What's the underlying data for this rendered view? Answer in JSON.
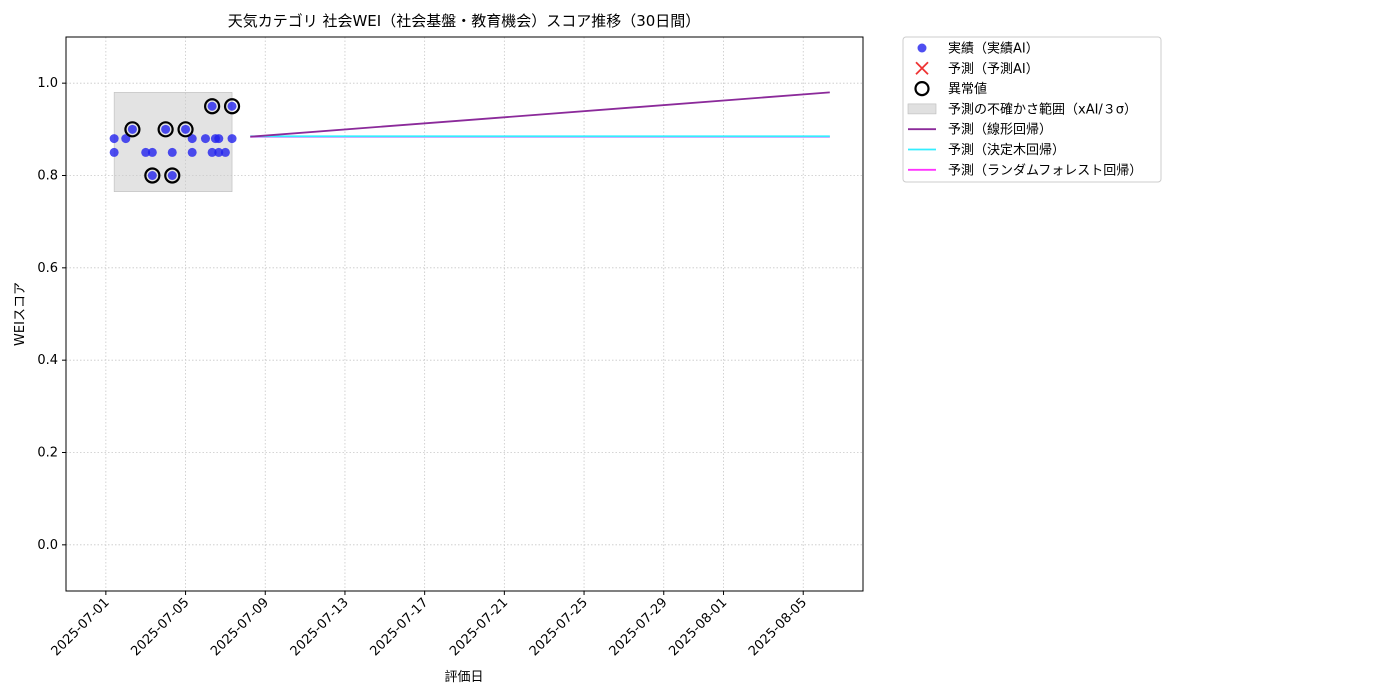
{
  "chart_data": {
    "type": "scatter",
    "title": "天気カテゴリ 社会WEI（社会基盤・教育機会）スコア推移（30日間）",
    "xlabel": "評価日",
    "ylabel": "WEIスコア",
    "xlim": [
      "2025-06-29",
      "2025-08-08"
    ],
    "ylim": [
      -0.1,
      1.1
    ],
    "yticks": [
      0.0,
      0.2,
      0.4,
      0.6,
      0.8,
      1.0
    ],
    "ytick_labels": [
      "0.0",
      "0.2",
      "0.4",
      "0.6",
      "0.8",
      "1.0"
    ],
    "xticks": [
      "2025-07-01",
      "2025-07-05",
      "2025-07-09",
      "2025-07-13",
      "2025-07-17",
      "2025-07-21",
      "2025-07-25",
      "2025-07-29",
      "2025-08-01",
      "2025-08-05"
    ],
    "grid": true,
    "legend_position": "outside upper right",
    "legend": [
      {
        "label": "実績（実績AI）",
        "kind": "dot",
        "color": "#2222ee"
      },
      {
        "label": "予測（予測AI）",
        "kind": "cross",
        "color": "#ee3333"
      },
      {
        "label": "異常値",
        "kind": "ring",
        "color": "#000000"
      },
      {
        "label": "予測の不確かさ範囲（xAI/３σ）",
        "kind": "band",
        "color": "#cccccc"
      },
      {
        "label": "予測（線形回帰）",
        "kind": "line",
        "color": "#8b2a9a"
      },
      {
        "label": "予測（決定木回帰）",
        "kind": "line",
        "color": "#33eeff"
      },
      {
        "label": "予測（ランダムフォレスト回帰）",
        "kind": "line",
        "color": "#ff33ff"
      }
    ],
    "actual": [
      {
        "x": "2025-07-01T10:00",
        "y": 0.88
      },
      {
        "x": "2025-07-01T10:00",
        "y": 0.85
      },
      {
        "x": "2025-07-02T00:00",
        "y": 0.88
      },
      {
        "x": "2025-07-02T08:00",
        "y": 0.9
      },
      {
        "x": "2025-07-03T00:00",
        "y": 0.85
      },
      {
        "x": "2025-07-03T08:00",
        "y": 0.8
      },
      {
        "x": "2025-07-03T08:00",
        "y": 0.85
      },
      {
        "x": "2025-07-04T00:00",
        "y": 0.9
      },
      {
        "x": "2025-07-04T08:00",
        "y": 0.8
      },
      {
        "x": "2025-07-04T08:00",
        "y": 0.85
      },
      {
        "x": "2025-07-05T00:00",
        "y": 0.9
      },
      {
        "x": "2025-07-05T08:00",
        "y": 0.88
      },
      {
        "x": "2025-07-05T08:00",
        "y": 0.85
      },
      {
        "x": "2025-07-06T00:00",
        "y": 0.88
      },
      {
        "x": "2025-07-06T08:00",
        "y": 0.95
      },
      {
        "x": "2025-07-06T08:00",
        "y": 0.85
      },
      {
        "x": "2025-07-06T12:00",
        "y": 0.88
      },
      {
        "x": "2025-07-06T16:00",
        "y": 0.88
      },
      {
        "x": "2025-07-06T16:00",
        "y": 0.85
      },
      {
        "x": "2025-07-07T00:00",
        "y": 0.85
      },
      {
        "x": "2025-07-07T08:00",
        "y": 0.95
      },
      {
        "x": "2025-07-07T08:00",
        "y": 0.88
      }
    ],
    "anomalies": [
      {
        "x": "2025-07-02T08:00",
        "y": 0.9
      },
      {
        "x": "2025-07-03T08:00",
        "y": 0.8
      },
      {
        "x": "2025-07-04T00:00",
        "y": 0.9
      },
      {
        "x": "2025-07-04T08:00",
        "y": 0.8
      },
      {
        "x": "2025-07-05T00:00",
        "y": 0.9
      },
      {
        "x": "2025-07-06T08:00",
        "y": 0.95
      },
      {
        "x": "2025-07-07T08:00",
        "y": 0.95
      }
    ],
    "uncertainty_band": {
      "x0": "2025-07-01T10:00",
      "x1": "2025-07-07T08:00",
      "y0": 0.765,
      "y1": 0.98
    },
    "forecast_lines": [
      {
        "name": "予測（ランダムフォレスト回帰）",
        "color": "#ff33ff",
        "x": [
          "2025-07-08T06:00",
          "2025-08-06T08:00"
        ],
        "y": [
          0.884,
          0.884
        ]
      },
      {
        "name": "予測（決定木回帰）",
        "color": "#33eeff",
        "x": [
          "2025-07-08T06:00",
          "2025-08-06T08:00"
        ],
        "y": [
          0.885,
          0.885
        ]
      },
      {
        "name": "予測（線形回帰）",
        "color": "#8b2a9a",
        "x": [
          "2025-07-08T06:00",
          "2025-08-06T08:00"
        ],
        "y": [
          0.884,
          0.98
        ]
      }
    ]
  }
}
